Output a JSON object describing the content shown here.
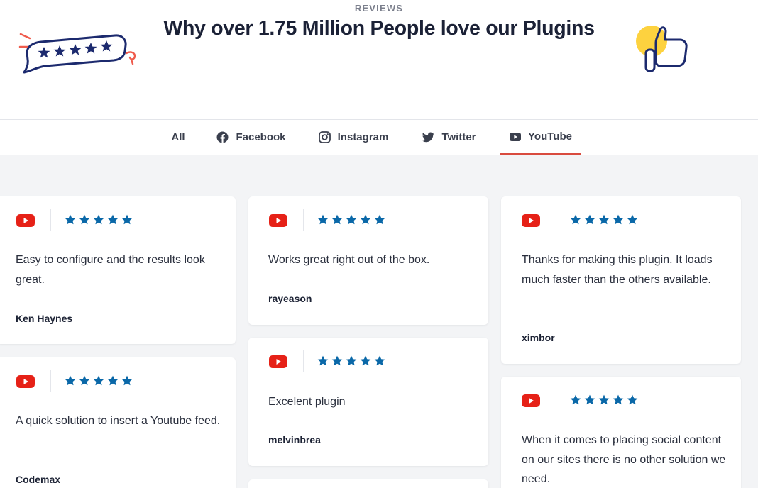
{
  "header": {
    "eyebrow": "REVIEWS",
    "title": "Why over 1.75 Million People love our Plugins"
  },
  "tabs": [
    {
      "label": "All",
      "icon": "none"
    },
    {
      "label": "Facebook",
      "icon": "facebook-icon"
    },
    {
      "label": "Instagram",
      "icon": "instagram-icon"
    },
    {
      "label": "Twitter",
      "icon": "twitter-icon"
    },
    {
      "label": "YouTube",
      "icon": "youtube-icon"
    }
  ],
  "active_tab": "YouTube",
  "colors": {
    "youtube_red": "#e62117",
    "star_blue": "#0a68a8",
    "tab_underline": "#d94b3f",
    "heading": "#1b2136",
    "feed_background": "#f3f4f6"
  },
  "reviews": [
    {
      "source": "youtube-icon",
      "rating": 5,
      "text": "Easy to configure and the results look great.",
      "author": "Ken Haynes"
    },
    {
      "source": "youtube-icon",
      "rating": 5,
      "text": "A quick solution to insert a Youtube feed.",
      "author": "Codemax"
    },
    {
      "source": "youtube-icon",
      "rating": 5,
      "text": "Works great right out of the box.",
      "author": "rayeason"
    },
    {
      "source": "youtube-icon",
      "rating": 5,
      "text": "Excelent plugin",
      "author": "melvinbrea"
    },
    {
      "source": "youtube-icon",
      "rating": 5,
      "text": "Thanks for making this plugin. It loads much faster than the others available.",
      "author": "ximbor"
    },
    {
      "source": "youtube-icon",
      "rating": 5,
      "text": "When it comes to placing social content on our sites there is no other solution we need.",
      "author": ""
    }
  ]
}
